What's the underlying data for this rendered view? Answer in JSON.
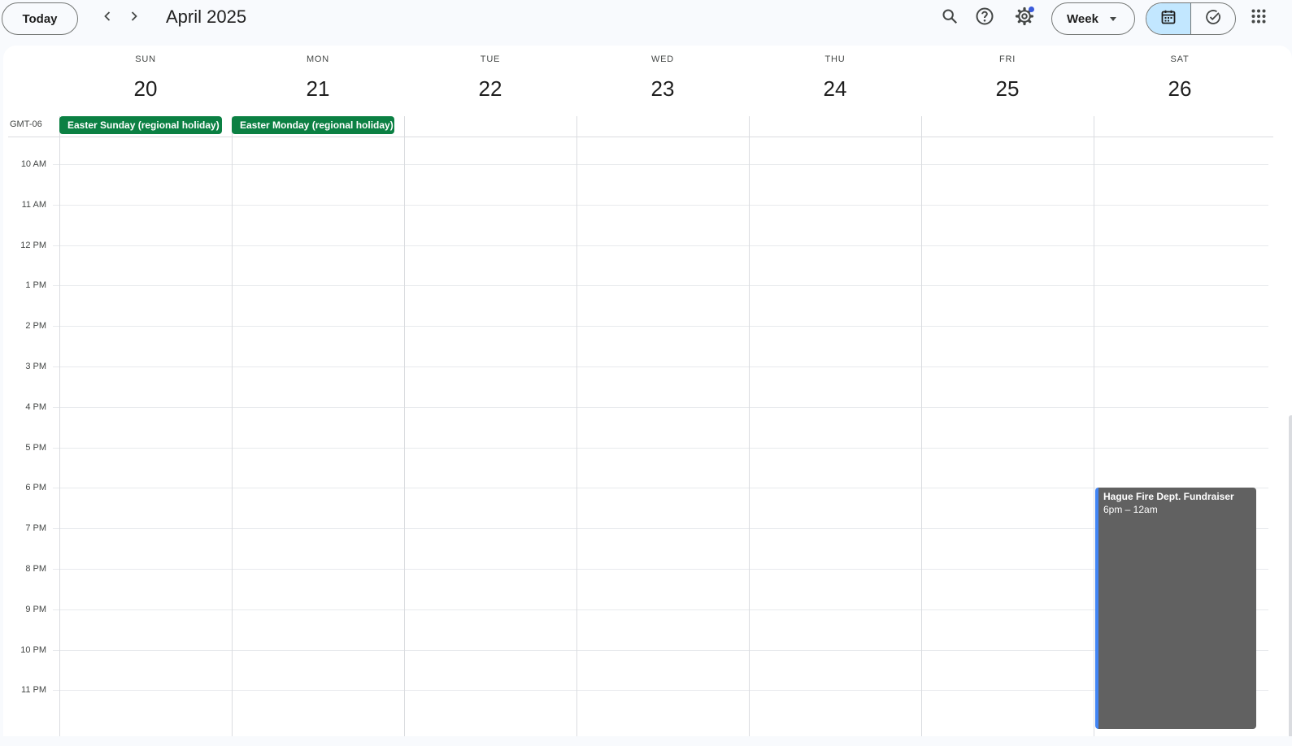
{
  "toolbar": {
    "today_label": "Today",
    "month_title": "April 2025",
    "view_label": "Week"
  },
  "days": [
    {
      "name": "SUN",
      "num": "20"
    },
    {
      "name": "MON",
      "num": "21"
    },
    {
      "name": "TUE",
      "num": "22"
    },
    {
      "name": "WED",
      "num": "23"
    },
    {
      "name": "THU",
      "num": "24"
    },
    {
      "name": "FRI",
      "num": "25"
    },
    {
      "name": "SAT",
      "num": "26"
    }
  ],
  "timezone": "GMT-06",
  "allday_events": [
    {
      "title": "Easter Sunday (regional holiday)",
      "color": "#0b8043"
    },
    {
      "title": "Easter Monday (regional holiday)",
      "color": "#0b8043"
    }
  ],
  "hours": [
    "10 AM",
    "11 AM",
    "12 PM",
    "1 PM",
    "2 PM",
    "3 PM",
    "4 PM",
    "5 PM",
    "6 PM",
    "7 PM",
    "8 PM",
    "9 PM",
    "10 PM",
    "11 PM"
  ],
  "timed_events": [
    {
      "title": "Hague Fire Dept. Fundraiser",
      "time": "6pm – 12am",
      "color": "#616161",
      "accent": "#4285f4"
    }
  ],
  "icons": {
    "prev": "chevron-left-icon",
    "next": "chevron-right-icon",
    "search": "search-icon",
    "help": "help-icon",
    "settings": "gear-icon",
    "calendar": "calendar-icon",
    "tasks": "task-check-icon",
    "apps": "apps-grid-icon"
  }
}
